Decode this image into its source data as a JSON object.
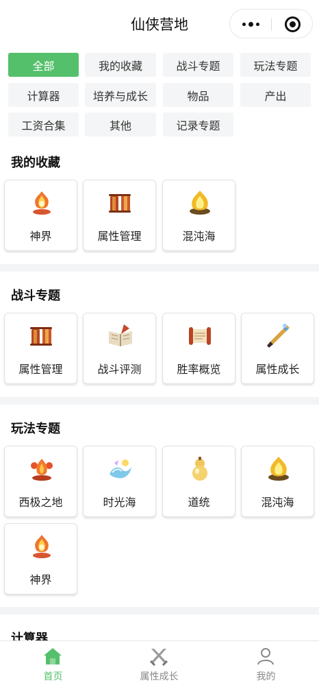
{
  "app": {
    "title": "仙侠营地"
  },
  "colors": {
    "accent": "#55c06b",
    "chip_bg": "#f4f5f6",
    "divider": "#f3f4f6"
  },
  "filters": [
    {
      "label": "全部",
      "active": true
    },
    {
      "label": "我的收藏"
    },
    {
      "label": "战斗专题"
    },
    {
      "label": "玩法专题"
    },
    {
      "label": "计算器"
    },
    {
      "label": "培养与成长"
    },
    {
      "label": "物品"
    },
    {
      "label": "产出"
    },
    {
      "label": "工资合集"
    },
    {
      "label": "其他"
    },
    {
      "label": "记录专题"
    }
  ],
  "sections": [
    {
      "title": "我的收藏",
      "items": [
        {
          "label": "神界",
          "icon": "flame-lotus-icon"
        },
        {
          "label": "属性管理",
          "icon": "scroll-icon"
        },
        {
          "label": "混沌海",
          "icon": "golden-fire-bowl-icon"
        }
      ]
    },
    {
      "title": "战斗专题",
      "items": [
        {
          "label": "属性管理",
          "icon": "scroll-icon"
        },
        {
          "label": "战斗评测",
          "icon": "open-book-icon"
        },
        {
          "label": "胜率概览",
          "icon": "unrolled-scroll-icon"
        },
        {
          "label": "属性成长",
          "icon": "magic-brush-icon"
        }
      ]
    },
    {
      "title": "玩法专题",
      "items": [
        {
          "label": "西极之地",
          "icon": "fire-altar-icon"
        },
        {
          "label": "时光海",
          "icon": "swirl-wave-icon"
        },
        {
          "label": "道统",
          "icon": "gourd-icon"
        },
        {
          "label": "混沌海",
          "icon": "golden-fire-bowl-icon"
        },
        {
          "label": "神界",
          "icon": "flame-lotus-icon"
        }
      ]
    },
    {
      "title": "计算器",
      "items": []
    }
  ],
  "tabbar": [
    {
      "label": "首页",
      "icon": "home-icon",
      "active": true
    },
    {
      "label": "属性成长",
      "icon": "crossed-swords-icon"
    },
    {
      "label": "我的",
      "icon": "user-icon"
    }
  ]
}
